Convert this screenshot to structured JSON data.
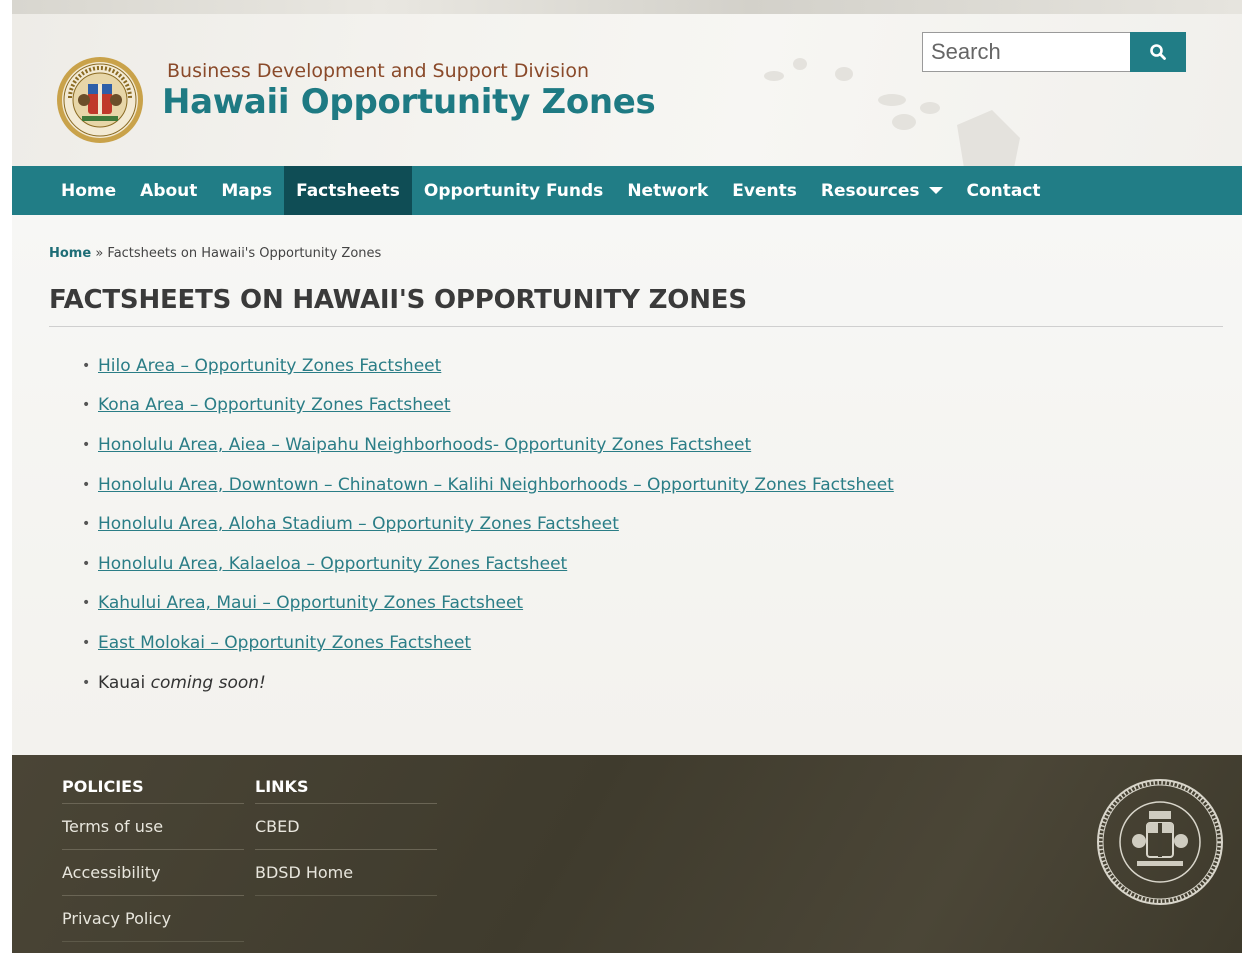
{
  "header": {
    "division": "Business Development and Support Division",
    "site_title": "Hawaii Opportunity Zones",
    "seal_text": "STATE OF HAWAII 1959",
    "search": {
      "placeholder": "Search",
      "value": ""
    }
  },
  "nav": {
    "items": [
      {
        "label": "Home"
      },
      {
        "label": "About"
      },
      {
        "label": "Maps"
      },
      {
        "label": "Factsheets",
        "active": true
      },
      {
        "label": "Opportunity Funds"
      },
      {
        "label": "Network"
      },
      {
        "label": "Events"
      },
      {
        "label": "Resources",
        "dropdown": true
      },
      {
        "label": "Contact"
      }
    ]
  },
  "breadcrumb": {
    "home": "Home",
    "separator": " » ",
    "current": "Factsheets on Hawaii's Opportunity Zones"
  },
  "page_title": "FACTSHEETS ON HAWAII'S OPPORTUNITY ZONES",
  "factsheets": [
    "Hilo Area – Opportunity Zones Factsheet",
    "Kona Area – Opportunity Zones Factsheet",
    "Honolulu Area, Aiea – Waipahu Neighborhoods- Opportunity Zones Factsheet",
    "Honolulu Area, Downtown – Chinatown – Kalihi Neighborhoods – Opportunity Zones Factsheet",
    "Honolulu Area, Aloha Stadium – Opportunity Zones Factsheet",
    "Honolulu Area, Kalaeloa – Opportunity Zones Factsheet",
    "Kahului Area, Maui – Opportunity Zones Factsheet",
    "East Molokai – Opportunity Zones Factsheet"
  ],
  "coming_soon": {
    "name": "Kauai",
    "note": "coming soon!"
  },
  "footer": {
    "policies": {
      "heading": "POLICIES",
      "items": [
        "Terms of use",
        "Accessibility",
        "Privacy Policy"
      ]
    },
    "links": {
      "heading": "LINKS",
      "items": [
        "CBED",
        "BDSD Home"
      ]
    },
    "seal_text": "STATE OF HAWAII 1959"
  },
  "colors": {
    "teal": "#217d86",
    "teal_dark": "#0f4d55",
    "link": "#2a7d86",
    "division": "#8a4a2a",
    "footer_bg": "#433f31"
  },
  "icons": {
    "search": "search-icon",
    "dropdown": "caret-down-icon",
    "header_seal": "state-seal-icon",
    "footer_seal": "state-seal-icon"
  }
}
